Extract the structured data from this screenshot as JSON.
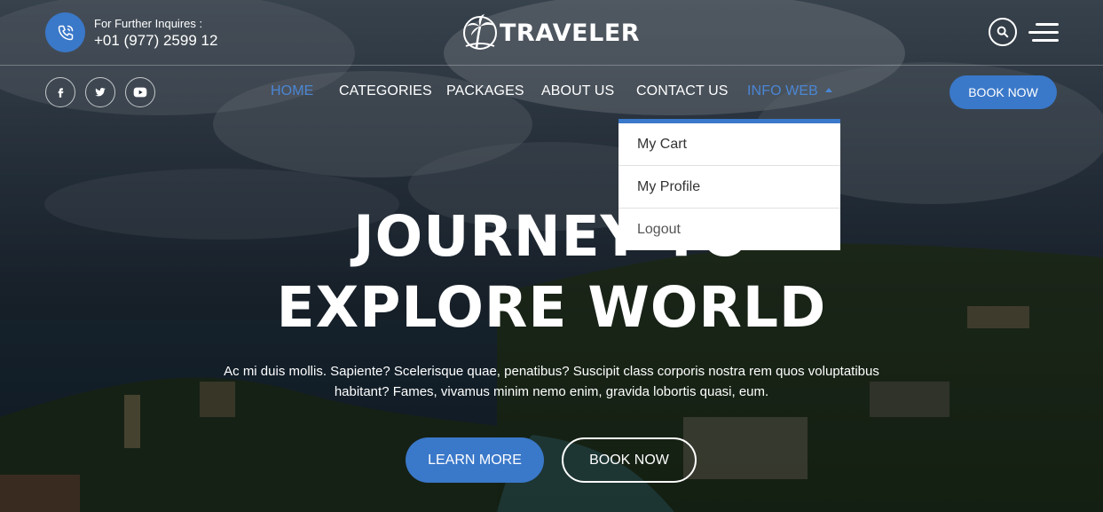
{
  "contact": {
    "label": "For Further Inquires :",
    "phone": "+01 (977) 2599 12"
  },
  "brand": {
    "name": "TRAVELER"
  },
  "nav": {
    "items": [
      {
        "label": "HOME",
        "active": true
      },
      {
        "label": "CATEGORIES"
      },
      {
        "label": "PACKAGES"
      },
      {
        "label": "ABOUT US"
      },
      {
        "label": "CONTACT US"
      },
      {
        "label": "INFO WEB",
        "expanded": true
      }
    ],
    "book_label": "BOOK NOW"
  },
  "dropdown": {
    "items": [
      {
        "label": "My Cart"
      },
      {
        "label": "My Profile"
      },
      {
        "label": "Logout"
      }
    ]
  },
  "hero": {
    "title_line1": "JOURNEY TO",
    "title_line2": "EXPLORE WORLD",
    "description": "Ac mi duis mollis. Sapiente? Scelerisque quae, penatibus? Suscipit class corporis nostra rem quos voluptatibus habitant? Fames, vivamus minim nemo enim, gravida lobortis quasi, eum.",
    "learn_more": "LEARN MORE",
    "book_now": "BOOK NOW"
  },
  "icons": {
    "phone": "phone-icon",
    "logo": "palm-tree-icon",
    "search": "search-icon",
    "menu": "menu-icon",
    "social": [
      "facebook-icon",
      "twitter-icon",
      "youtube-icon"
    ]
  },
  "colors": {
    "accent": "#3a78c9",
    "nav_active": "#4a86d4",
    "dropdown_bg": "#ffffff"
  }
}
